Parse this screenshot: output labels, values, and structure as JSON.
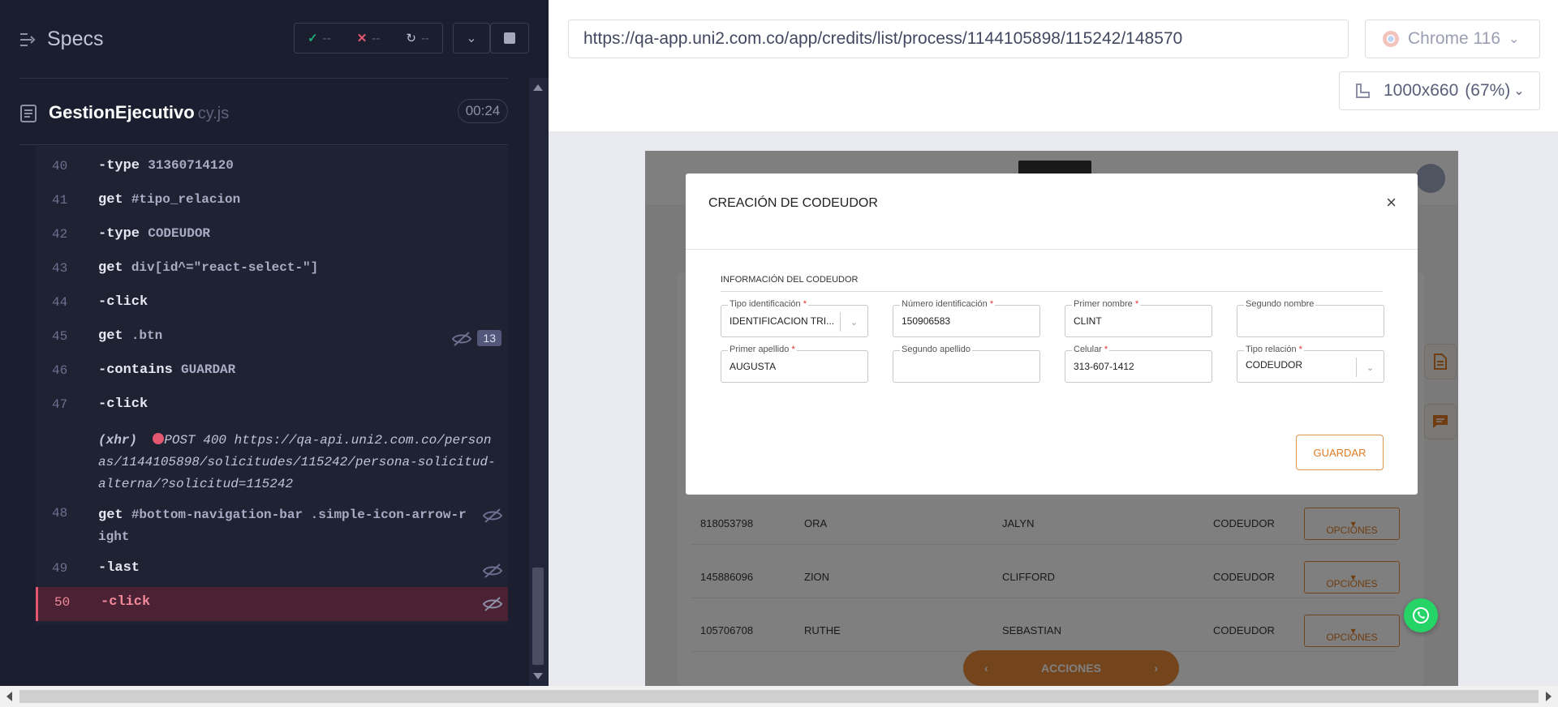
{
  "reporter": {
    "specs_label": "Specs",
    "stats": {
      "passed": "--",
      "failed": "--",
      "pending": "--"
    },
    "spec_name": "GestionEjecutivo",
    "spec_ext": "cy.js",
    "timer": "00:24",
    "commands": [
      {
        "num": "40",
        "method": "-type",
        "arg": "31360714120"
      },
      {
        "num": "41",
        "method": "get",
        "arg": "#tipo_relacion"
      },
      {
        "num": "42",
        "method": "-type",
        "arg": "CODEUDOR"
      },
      {
        "num": "43",
        "method": "get",
        "arg": "div[id^=\"react-select-\"]"
      },
      {
        "num": "44",
        "method": "-click",
        "arg": ""
      },
      {
        "num": "45",
        "method": "get",
        "arg": ".btn",
        "badge": "13"
      },
      {
        "num": "46",
        "method": "-contains",
        "arg": "GUARDAR"
      },
      {
        "num": "47",
        "method": "-click",
        "arg": ""
      },
      {
        "num": "",
        "method": "(xhr)",
        "arg": "POST 400 https://qa-api.uni2.com.co/personas/1144105898/solicitudes/115242/persona-solicitud-alterna/?solicitud=115242"
      },
      {
        "num": "48",
        "method": "get",
        "arg": "#bottom-navigation-bar .simple-icon-arrow-right"
      },
      {
        "num": "49",
        "method": "-last",
        "arg": ""
      },
      {
        "num": "50",
        "method": "-click",
        "arg": ""
      }
    ]
  },
  "aut": {
    "url": "https://qa-app.uni2.com.co/app/credits/list/process/1144105898/115242/148570",
    "browser": "Chrome 116",
    "viewport": "1000x660",
    "zoom": "(67%)"
  },
  "app": {
    "rows": [
      {
        "id": "818053798",
        "name": "ORA",
        "last": "JALYN",
        "role": "CODEUDOR",
        "action": "OPCIONES"
      },
      {
        "id": "145886096",
        "name": "ZION",
        "last": "CLIFFORD",
        "role": "CODEUDOR",
        "action": "OPCIONES"
      },
      {
        "id": "105706708",
        "name": "RUTHE",
        "last": "SEBASTIAN",
        "role": "CODEUDOR",
        "action": "OPCIONES"
      }
    ],
    "acciones_label": "ACCIONES",
    "modal": {
      "title": "CREACIÓN DE CODEUDOR",
      "section": "INFORMACIÓN DEL CODEUDOR",
      "fields": {
        "tipo_identificacion": {
          "label": "Tipo identificación",
          "value": "IDENTIFICACION TRI..."
        },
        "numero_identificacion": {
          "label": "Número identificación",
          "value": "150906583"
        },
        "primer_nombre": {
          "label": "Primer nombre",
          "value": "CLINT"
        },
        "segundo_nombre": {
          "label": "Segundo nombre",
          "value": ""
        },
        "primer_apellido": {
          "label": "Primer apellido",
          "value": "AUGUSTA"
        },
        "segundo_apellido": {
          "label": "Segundo apellido",
          "value": ""
        },
        "celular": {
          "label": "Celular",
          "value": "313-607-1412"
        },
        "tipo_relacion": {
          "label": "Tipo relación",
          "value": "CODEUDOR"
        }
      },
      "save_label": "GUARDAR"
    }
  },
  "colors": {
    "reporter_bg": "#1b1e2e",
    "failed_row": "#4a2233",
    "accent_orange": "#e8893a",
    "passed": "#1fa971",
    "failed": "#e45770"
  }
}
